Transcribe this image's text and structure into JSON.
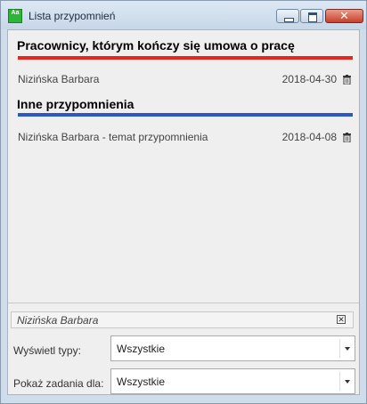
{
  "window": {
    "title": "Lista przypomnień",
    "icon": "app-calendar-icon",
    "controls": {
      "minimize": "minimize-icon",
      "maximize": "maximize-icon",
      "close": "close-icon"
    }
  },
  "sections": [
    {
      "title": "Pracownicy, którym kończy się umowa o pracę",
      "bar_color": "#e8261c",
      "items": [
        {
          "label": "Nizińska Barbara",
          "date": "2018-04-30",
          "icon": "trash-icon"
        }
      ]
    },
    {
      "title": "Inne przypomnienia",
      "bar_color": "#2d57c4",
      "items": [
        {
          "label": "Nizińska Barbara - temat przypomnienia",
          "date": "2018-04-08",
          "icon": "trash-icon"
        }
      ]
    }
  ],
  "filter": {
    "person": "Nizińska Barbara",
    "clear_icon": "clear-icon",
    "types_label": "Wyświetl typy:",
    "types_value": "Wszystkie",
    "tasks_label": "Pokaż zadania dla:",
    "tasks_value": "Wszystkie"
  }
}
